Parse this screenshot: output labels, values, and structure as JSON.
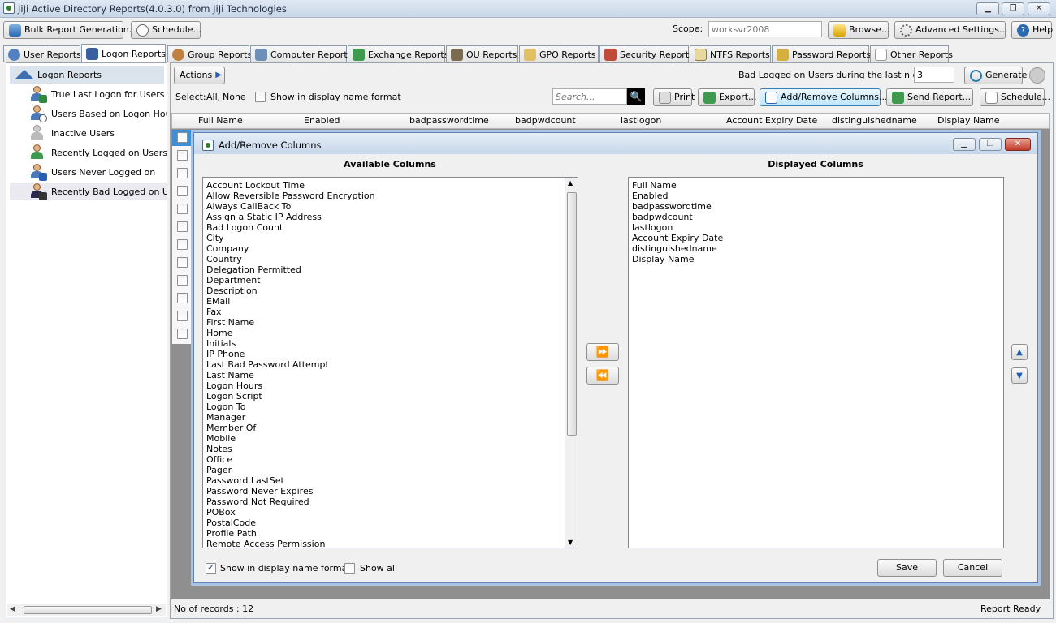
{
  "window": {
    "title": "JiJi Active Directory Reports(4.0.3.0) from JiJi Technologies",
    "min": "▁",
    "restore": "❐",
    "close": "✕"
  },
  "toolbar": {
    "bulk": "Bulk Report Generation...",
    "schedule": "Schedule...",
    "scope_label": "Scope:",
    "scope_value": "worksvr2008",
    "browse": "Browse...",
    "advanced": "Advanced  Settings...",
    "help": "Help"
  },
  "tabs": [
    "User Reports",
    "Logon Reports",
    "Group Reports",
    "Computer Reports",
    "Exchange Reports",
    "OU Reports",
    "GPO Reports",
    "Security Reports",
    "NTFS Reports",
    "Password Reports",
    "Other Reports"
  ],
  "tree": {
    "root": "Logon Reports",
    "items": [
      "True Last Logon for Users",
      "Users Based on Logon Hours",
      "Inactive Users",
      "Recently Logged on Users",
      "Users Never Logged on",
      "Recently Bad Logged on Users"
    ]
  },
  "actions": {
    "label": "Actions",
    "bad_logged_label": "Bad Logged on Users during the last n days:",
    "days": "3",
    "generate": "Generate"
  },
  "select": {
    "label": "Select:",
    "all": "All,",
    "none": "None",
    "display_name_format": "Show in display name format"
  },
  "search": {
    "placeholder": "Search..."
  },
  "buttons": {
    "print": "Print",
    "export": "Export...",
    "add_remove": "Add/Remove Columns...",
    "send": "Send Report...",
    "schedule": "Schedule..."
  },
  "grid": {
    "columns": [
      "Full Name",
      "Enabled",
      "badpasswordtime",
      "badpwdcount",
      "lastlogon",
      "Account Expiry Date",
      "distinguishedname",
      "Display Name"
    ]
  },
  "dialog": {
    "title": "Add/Remove Columns",
    "available_header": "Available Columns",
    "displayed_header": "Displayed Columns",
    "available": [
      "Account Lockout Time",
      "Allow Reversible Password Encryption",
      "Always CallBack To",
      "Assign a Static IP Address",
      "Bad Logon Count",
      "City",
      "Company",
      "Country",
      "Delegation Permitted",
      "Department",
      "Description",
      "EMail",
      "Fax",
      "First Name",
      "Home",
      "Initials",
      "IP Phone",
      "Last Bad Password Attempt",
      "Last Name",
      "Logon Hours",
      "Logon Script",
      "Logon To",
      "Manager",
      "Member Of",
      "Mobile",
      "Notes",
      "Office",
      "Pager",
      "Password LastSet",
      "Password Never Expires",
      "Password Not Required",
      "POBox",
      "PostalCode",
      "Profile Path",
      "Remote Access Permission"
    ],
    "displayed": [
      "Full Name",
      "Enabled",
      "badpasswordtime",
      "badpwdcount",
      "lastlogon",
      "Account Expiry Date",
      "distinguishedname",
      "Display Name"
    ],
    "add_arrow": "⏩",
    "remove_arrow": "⏪",
    "up": "▲",
    "down": "▼",
    "show_display_name": "Show in display name format",
    "show_all": "Show all",
    "save": "Save",
    "cancel": "Cancel"
  },
  "status": {
    "records": "No of records : 12",
    "ready": "Report Ready"
  }
}
